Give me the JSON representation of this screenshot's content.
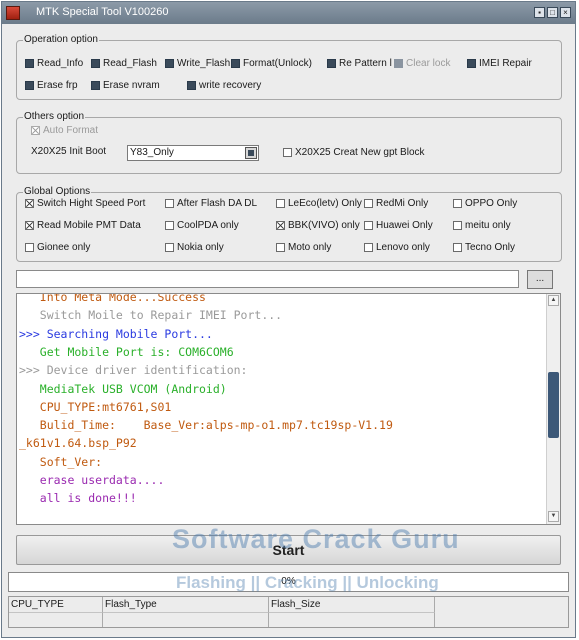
{
  "window": {
    "title": "MTK Special Tool V100260"
  },
  "operation": {
    "legend": "Operation option",
    "items": [
      {
        "label": "Read_Info",
        "state": "filled"
      },
      {
        "label": "Read_Flash",
        "state": "filled"
      },
      {
        "label": "Write_Flash",
        "state": "filled"
      },
      {
        "label": "Format(Unlock)",
        "state": "filled"
      },
      {
        "label": "Re Pattern l",
        "state": "filled"
      },
      {
        "label": "Clear lock",
        "state": "filled-disabled"
      },
      {
        "label": "IMEI Repair",
        "state": "filled"
      },
      {
        "label": "Erase frp",
        "state": "filled"
      },
      {
        "label": "Erase nvram",
        "state": "filled"
      },
      {
        "label": "write recovery",
        "state": "filled"
      }
    ]
  },
  "others": {
    "legend": "Others option",
    "auto_format": "Auto Format",
    "init_boot_label": "X20X25 Init Boot",
    "init_boot_value": "Y83_Only",
    "gpt_label": "X20X25 Creat New gpt Block"
  },
  "global": {
    "legend": "Global Options",
    "items": [
      {
        "label": "Switch Hight Speed Port",
        "state": "checked"
      },
      {
        "label": "After Flash DA DL",
        "state": "empty"
      },
      {
        "label": "LeEco(letv) Only",
        "state": "empty"
      },
      {
        "label": "RedMi Only",
        "state": "empty"
      },
      {
        "label": "OPPO Only",
        "state": "empty"
      },
      {
        "label": "Read Mobile PMT Data",
        "state": "checked"
      },
      {
        "label": "CoolPDA only",
        "state": "empty"
      },
      {
        "label": "BBK(VIVO) only",
        "state": "checked"
      },
      {
        "label": "Huawei Only",
        "state": "empty"
      },
      {
        "label": "meitu only",
        "state": "empty"
      },
      {
        "label": "Gionee only",
        "state": "empty"
      },
      {
        "label": "Nokia only",
        "state": "empty"
      },
      {
        "label": "Moto only",
        "state": "empty"
      },
      {
        "label": "Lenovo only",
        "state": "empty"
      },
      {
        "label": "Tecno Only",
        "state": "empty"
      }
    ]
  },
  "file": {
    "path": "",
    "browse_label": "..."
  },
  "log": {
    "lines": [
      {
        "text": "   Into Meta Mode...Success",
        "color": "#c05a10"
      },
      {
        "text": "   Switch Moile to Repair IMEI Port...",
        "color": "#9a9a9a"
      },
      {
        "text": ">>> Searching Mobile Port...",
        "color": "#2a3ae0"
      },
      {
        "text": "   Get Mobile Port is: COM6COM6",
        "color": "#2ab02a"
      },
      {
        "text": ">>> Device driver identification:",
        "color": "#9a9a9a"
      },
      {
        "text": "   MediaTek USB VCOM (Android)",
        "color": "#2ab02a"
      },
      {
        "text": "   CPU_TYPE:mt6761,S01",
        "color": "#c05a10"
      },
      {
        "text": "   Bulid_Time:    Base_Ver:alps-mp-o1.mp7.tc19sp-V1.19",
        "color": "#c05a10"
      },
      {
        "text": "_k61v1.64.bsp_P92",
        "color": "#c05a10"
      },
      {
        "text": "   Soft_Ver:",
        "color": "#c05a10"
      },
      {
        "text": "   erase userdata....",
        "color": "#9a2ab0"
      },
      {
        "text": "   all is done!!!",
        "color": "#9a2ab0"
      }
    ]
  },
  "start_label": "Start",
  "progress": {
    "text": "0%",
    "value": 0
  },
  "status": {
    "cpu_type": "CPU_TYPE",
    "flash_type": "Flash_Type",
    "flash_size": "Flash_Size"
  },
  "watermark": {
    "line1": "Software Crack Guru",
    "line2": "Flashing || Cracking || Unlocking"
  }
}
